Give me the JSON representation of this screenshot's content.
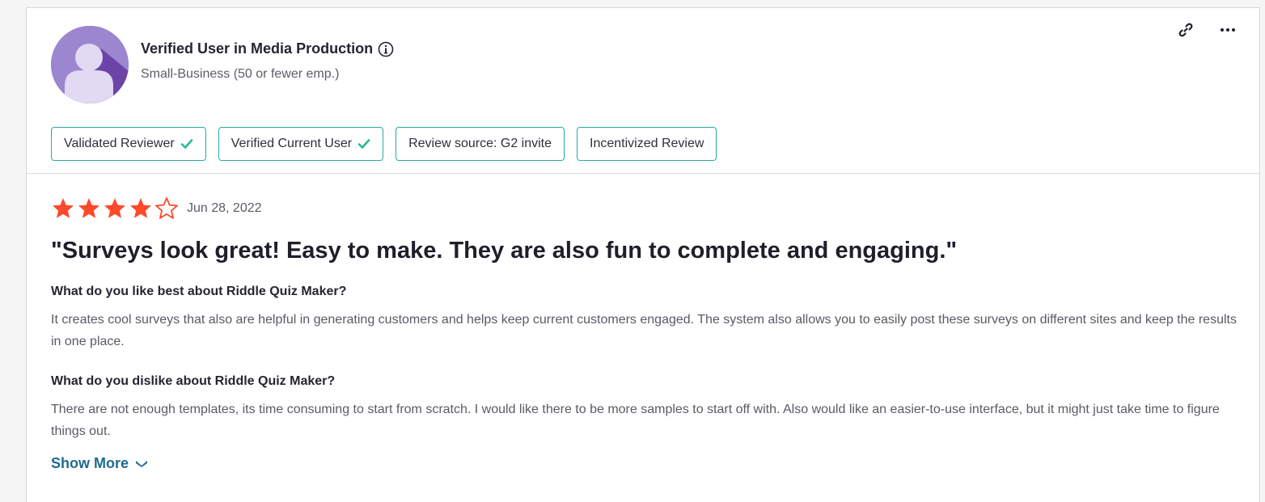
{
  "user": {
    "name": "Verified User in Media Production",
    "company_size": "Small-Business (50 or fewer emp.)",
    "avatar_icon": "user-avatar-icon"
  },
  "actions": {
    "link_icon": "link-icon",
    "more_icon": "more-options-icon"
  },
  "badges": [
    {
      "label": "Validated Reviewer",
      "verified": true
    },
    {
      "label": "Verified Current User",
      "verified": true
    },
    {
      "label": "Review source: G2 invite",
      "verified": false
    },
    {
      "label": "Incentivized Review",
      "verified": false
    }
  ],
  "review": {
    "rating": 4,
    "max_rating": 5,
    "date": "Jun 28, 2022",
    "title": "\"Surveys look great! Easy to make. They are also fun to complete and engaging.\"",
    "qa": [
      {
        "question": "What do you like best about Riddle Quiz Maker?",
        "answer": "It creates cool surveys that also are helpful in generating customers and helps keep current customers engaged. The system also allows you to easily post these surveys on different sites and keep the results in one place."
      },
      {
        "question": "What do you dislike about Riddle Quiz Maker?",
        "answer": "There are not enough templates, its time consuming to start from scratch. I would like there to be more samples to start off with. Also would like an easier-to-use interface, but it might just take time to figure things out."
      }
    ],
    "show_more_label": "Show More"
  },
  "colors": {
    "star": "#ff492c",
    "badge_border": "#29a9a5",
    "check": "#27b89a",
    "link": "#1f6b8f",
    "avatar_bg": "#9b86cf"
  }
}
